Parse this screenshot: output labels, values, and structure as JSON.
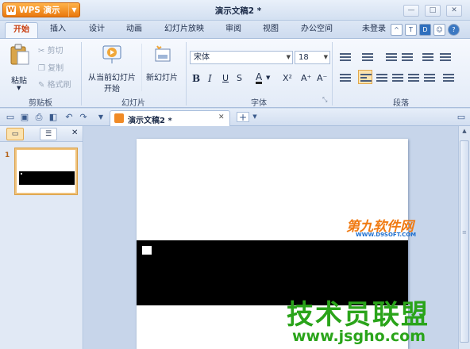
{
  "app": {
    "name": "WPS 演示",
    "doc_title": "演示文稿2 *",
    "window_controls": {
      "minimize": "—",
      "maximize": "□",
      "close": "✕"
    }
  },
  "tabs": [
    {
      "label": "开始",
      "active": true
    },
    {
      "label": "插入",
      "active": false
    },
    {
      "label": "设计",
      "active": false
    },
    {
      "label": "动画",
      "active": false
    },
    {
      "label": "幻灯片放映",
      "active": false
    },
    {
      "label": "审阅",
      "active": false
    },
    {
      "label": "视图",
      "active": false
    },
    {
      "label": "办公空间",
      "active": false
    }
  ],
  "account": {
    "login_label": "未登录"
  },
  "ribbon": {
    "clipboard": {
      "label": "剪贴板",
      "paste": "粘贴",
      "cut": "剪切",
      "copy": "复制",
      "format_painter": "格式刷"
    },
    "slides": {
      "label": "幻灯片",
      "from_current_line1": "从当前幻灯片",
      "from_current_line2": "开始",
      "new_slide": "新幻灯片"
    },
    "font": {
      "label": "字体",
      "font_name": "宋体",
      "font_size": "18",
      "bold": "B",
      "italic": "I",
      "underline": "U",
      "strike": "S",
      "font_color": "A",
      "superscript": "X²",
      "grow": "A⁺",
      "shrink": "A⁻"
    },
    "paragraph": {
      "label": "段落"
    }
  },
  "doc_tabs": [
    {
      "label": "演示文稿2 *",
      "close": "✕"
    }
  ],
  "new_tab": "+",
  "slide_panel": {
    "close": "✕",
    "slide_number": "1"
  },
  "watermarks": {
    "site1": "第九软件网",
    "site1_url": "WWW.D9SOFT.COM",
    "site2": "技术员联盟",
    "site2_url": "www.jsgho.com"
  },
  "colors": {
    "accent": "#e9780e",
    "active_tab_text": "#c93d0e",
    "watermark_orange": "#f07a12",
    "watermark_green": "#2aa41a"
  }
}
